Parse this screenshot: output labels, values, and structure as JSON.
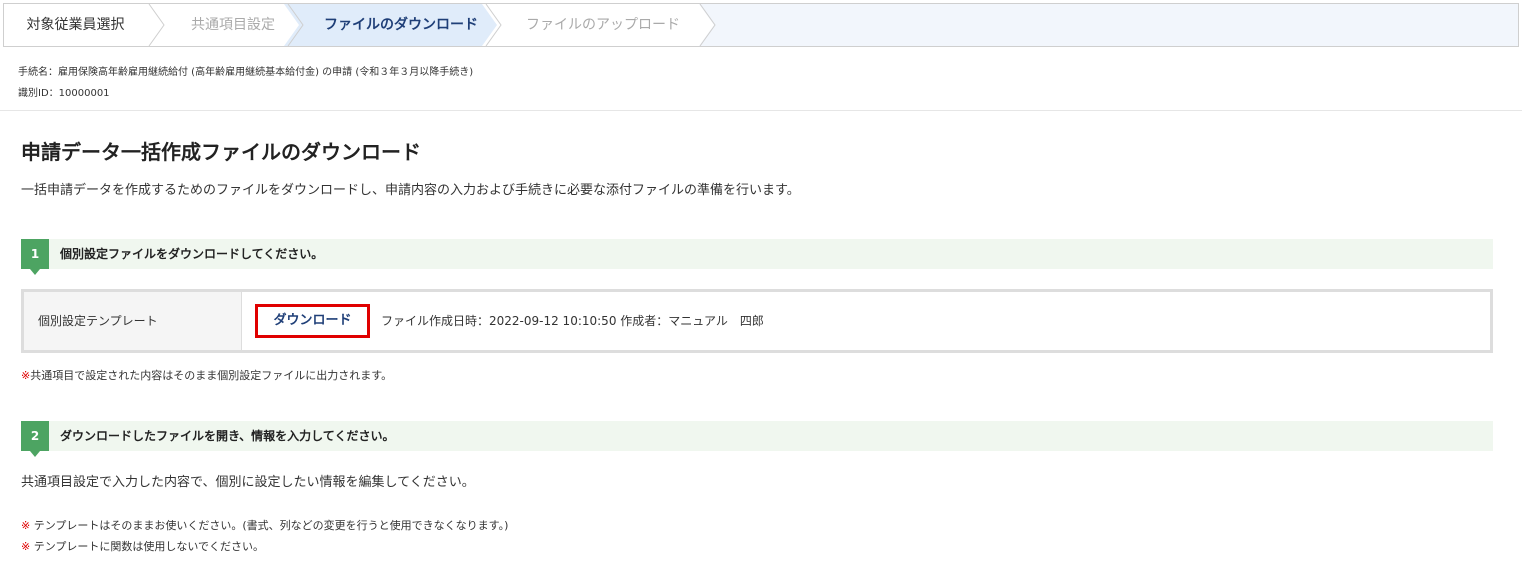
{
  "steps": [
    {
      "label": "対象従業員選択",
      "state": "done"
    },
    {
      "label": "共通項目設定",
      "state": "inactive"
    },
    {
      "label": "ファイルのダウンロード",
      "state": "active"
    },
    {
      "label": "ファイルのアップロード",
      "state": "inactive"
    }
  ],
  "meta": {
    "procedure": "手続名：雇用保険高年齢雇用継続給付 (高年齢雇用継続基本給付金) の申請 (令和３年３月以降手続き)",
    "id": "識別ID：10000001"
  },
  "page": {
    "title": "申請データ一括作成ファイルのダウンロード",
    "description": "一括申請データを作成するためのファイルをダウンロードし、申請内容の入力および手続きに必要な添付ファイルの準備を行います。"
  },
  "section1": {
    "number": "1",
    "title": "個別設定ファイルをダウンロードしてください。",
    "row_label": "個別設定テンプレート",
    "button_label": "ダウンロード",
    "file_info": "ファイル作成日時：2022-09-12 10:10:50 作成者：マニュアル　四郎",
    "note_mark": "※",
    "note": "共通項目で設定された内容はそのまま個別設定ファイルに出力されます。"
  },
  "section2": {
    "number": "2",
    "title": "ダウンロードしたファイルを開き、情報を入力してください。",
    "body": "共通項目設定で入力した内容で、個別に設定したい情報を編集してください。",
    "notes": [
      {
        "mark": "※",
        "text": "テンプレートはそのままお使いください。(書式、列などの変更を行うと使用できなくなります。)"
      },
      {
        "mark": "※",
        "text": "テンプレートに関数は使用しないでください。"
      }
    ]
  },
  "colors": {
    "active_step": "#1f3f78",
    "section_badge": "#4da462",
    "highlight_border": "#e00000"
  }
}
